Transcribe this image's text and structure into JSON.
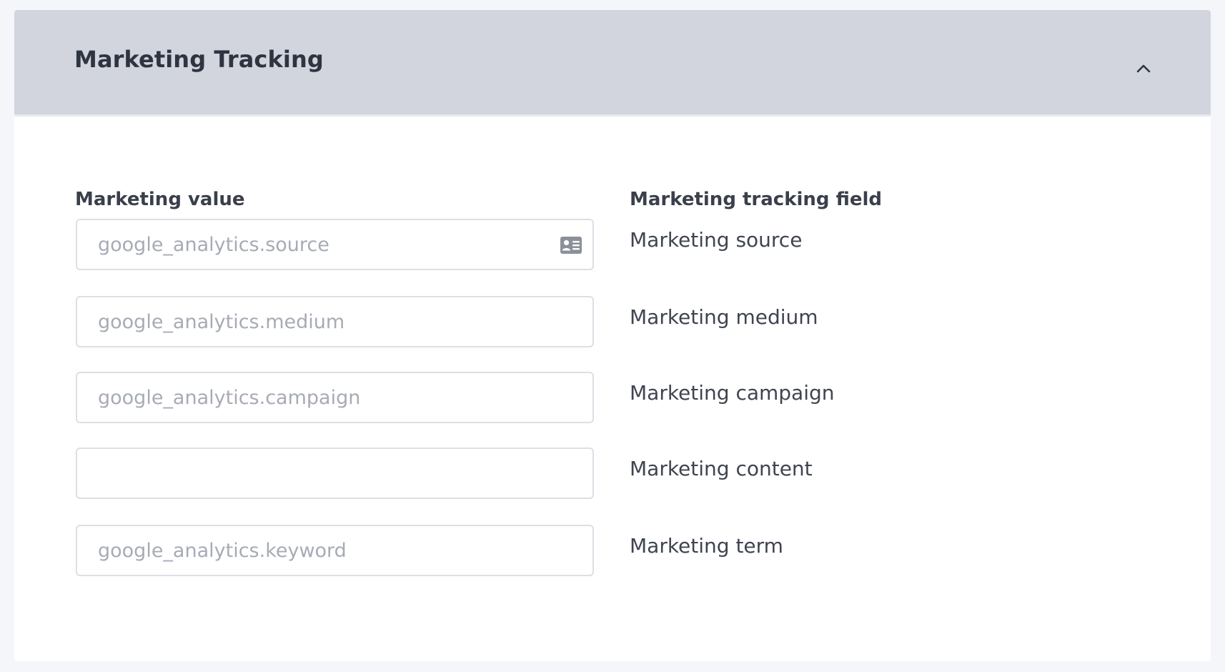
{
  "section": {
    "title": "Marketing Tracking",
    "collapse_icon": "chevron-up-icon"
  },
  "columns": {
    "value_header": "Marketing value",
    "field_header": "Marketing tracking field"
  },
  "rows": [
    {
      "value": "",
      "placeholder": "google_analytics.source",
      "label": "Marketing source",
      "icon": "contact-card-icon"
    },
    {
      "value": "",
      "placeholder": "google_analytics.medium",
      "label": "Marketing medium"
    },
    {
      "value": "",
      "placeholder": "google_analytics.campaign",
      "label": "Marketing campaign"
    },
    {
      "value": "",
      "placeholder": "",
      "label": "Marketing content"
    },
    {
      "value": "",
      "placeholder": "google_analytics.keyword",
      "label": "Marketing term"
    }
  ],
  "colors": {
    "page_background": "#f5f6fa",
    "header_background": "#d2d5de",
    "panel_background": "#ffffff",
    "input_border": "#dcdfe6",
    "placeholder_text": "#a7abb4",
    "label_text": "#3f4450"
  }
}
